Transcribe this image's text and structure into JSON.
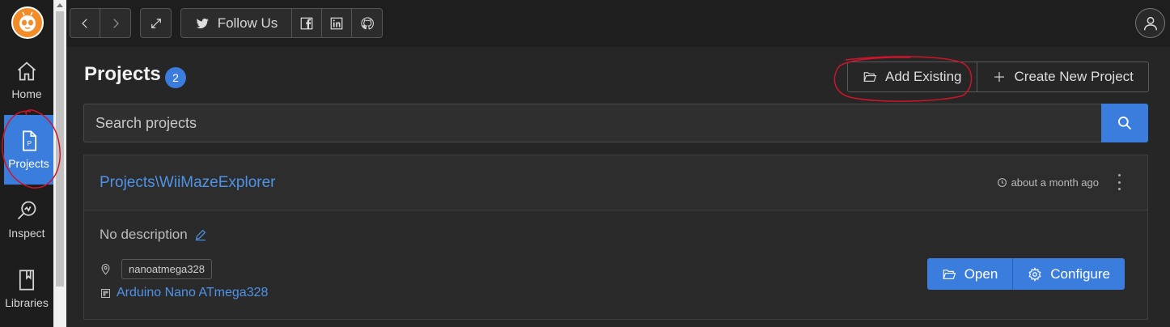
{
  "sidebar": {
    "items": [
      {
        "label": "Home",
        "icon": "home-icon"
      },
      {
        "label": "Projects",
        "icon": "projects-icon"
      },
      {
        "label": "Inspect",
        "icon": "inspect-icon"
      },
      {
        "label": "Libraries",
        "icon": "libraries-icon"
      }
    ],
    "active": "Projects"
  },
  "topbar": {
    "follow_label": "Follow Us"
  },
  "page": {
    "title": "Projects",
    "count": "2",
    "add_existing_label": "Add Existing",
    "create_new_label": "Create New Project"
  },
  "search": {
    "placeholder": "Search projects"
  },
  "project": {
    "name": "Projects\\WiiMazeExplorer",
    "time": "about a month ago",
    "description": "No description",
    "env": "nanoatmega328",
    "board": "Arduino Nano ATmega328",
    "open_label": "Open",
    "configure_label": "Configure"
  },
  "colors": {
    "accent": "#3b7ddd",
    "link": "#4f93e8",
    "annotation": "#d0142a"
  }
}
